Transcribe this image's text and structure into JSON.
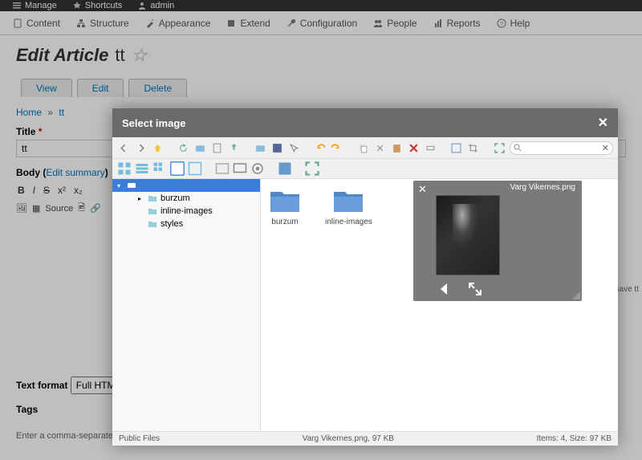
{
  "topbar": {
    "manage": "Manage",
    "shortcuts": "Shortcuts",
    "admin": "admin"
  },
  "adminbar": {
    "content": "Content",
    "structure": "Structure",
    "appearance": "Appearance",
    "extend": "Extend",
    "configuration": "Configuration",
    "people": "People",
    "reports": "Reports",
    "help": "Help"
  },
  "page": {
    "heading_prefix": "Edit Article",
    "heading_title": "tt",
    "tabs": {
      "view": "View",
      "edit": "Edit",
      "delete": "Delete"
    },
    "breadcrumb": {
      "home": "Home",
      "current": "tt"
    },
    "title_label": "Title",
    "title_value": "tt",
    "body_label": "Body",
    "edit_summary": "Edit summary",
    "source_label": "Source",
    "text_format_label": "Text format",
    "text_format_value": "Full HTML",
    "tags_label": "Tags",
    "tags_hint": "Enter a comma-separated list. For example: Amsterdam, Mexico City, \"Cleveland, Ohio\"",
    "savemsg": "save tt"
  },
  "dialog": {
    "title": "Select image",
    "search_placeholder": "",
    "tree": {
      "root": "",
      "items": [
        "burzum",
        "inline-images",
        "styles"
      ]
    },
    "files": {
      "f1": "burzum",
      "f2": "inline-images",
      "f3": "Varg Vikernes.png"
    },
    "preview": {
      "name": "Varg Vikernes.png"
    },
    "status": {
      "left": "Public Files",
      "center": "Varg Vikernes.png, 97 KB",
      "right": "Items: 4, Size: 97 KB"
    }
  }
}
